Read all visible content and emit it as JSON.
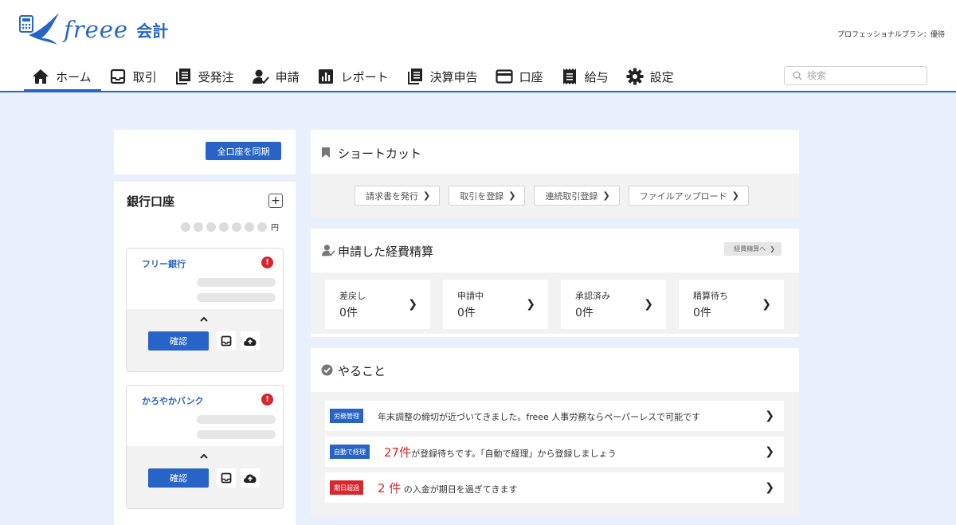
{
  "app": {
    "logo_word": "freee",
    "logo_product": "会計",
    "plan_label": "プロフェッショナルプラン：優待",
    "accent_color": "#2864c8"
  },
  "nav": {
    "items": [
      {
        "label": "ホーム",
        "icon": "home-icon",
        "active": true
      },
      {
        "label": "取引",
        "icon": "inbox-icon"
      },
      {
        "label": "受発注",
        "icon": "document-icon"
      },
      {
        "label": "申請",
        "icon": "person-check-icon"
      },
      {
        "label": "レポート",
        "icon": "bar-chart-icon"
      },
      {
        "label": "決算申告",
        "icon": "document-icon"
      },
      {
        "label": "口座",
        "icon": "credit-card-icon"
      },
      {
        "label": "給与",
        "icon": "receipt-icon"
      },
      {
        "label": "設定",
        "icon": "gear-icon"
      }
    ]
  },
  "search": {
    "placeholder": "検索"
  },
  "sync": {
    "label": "全口座を同期"
  },
  "bank": {
    "title": "銀行口座",
    "yen": "円",
    "accounts": [
      {
        "name": "フリー銀行",
        "alert": "!",
        "confirm_label": "確認"
      },
      {
        "name": "かろやかバンク",
        "alert": "!",
        "confirm_label": "確認"
      }
    ]
  },
  "shortcuts": {
    "title": "ショートカット",
    "buttons": [
      "請求書を発行",
      "取引を登録",
      "連続取引登録",
      "ファイルアップロード"
    ]
  },
  "expenses": {
    "title": "申請した経費精算",
    "link": "経費精算へ",
    "stats": [
      {
        "label": "差戻し",
        "value": "0件"
      },
      {
        "label": "申請中",
        "value": "0件"
      },
      {
        "label": "承認済み",
        "value": "0件"
      },
      {
        "label": "精算待ち",
        "value": "0件"
      }
    ]
  },
  "todo": {
    "title": "やること",
    "items": [
      {
        "tag": "労務管理",
        "tag_color": "#2864c8",
        "count": "",
        "text": "年末調整の締切が近づいてきました。freee 人事労務ならペーパーレスで可能です"
      },
      {
        "tag": "自動で経理",
        "tag_color": "#2864c8",
        "count": "27件",
        "text": "が登録待ちです。「自動で経理」から登録しましょう"
      },
      {
        "tag": "期日超過",
        "tag_color": "#d9262c",
        "count": "2 件",
        "text": " の入金が期日を過ぎてきます"
      }
    ]
  }
}
